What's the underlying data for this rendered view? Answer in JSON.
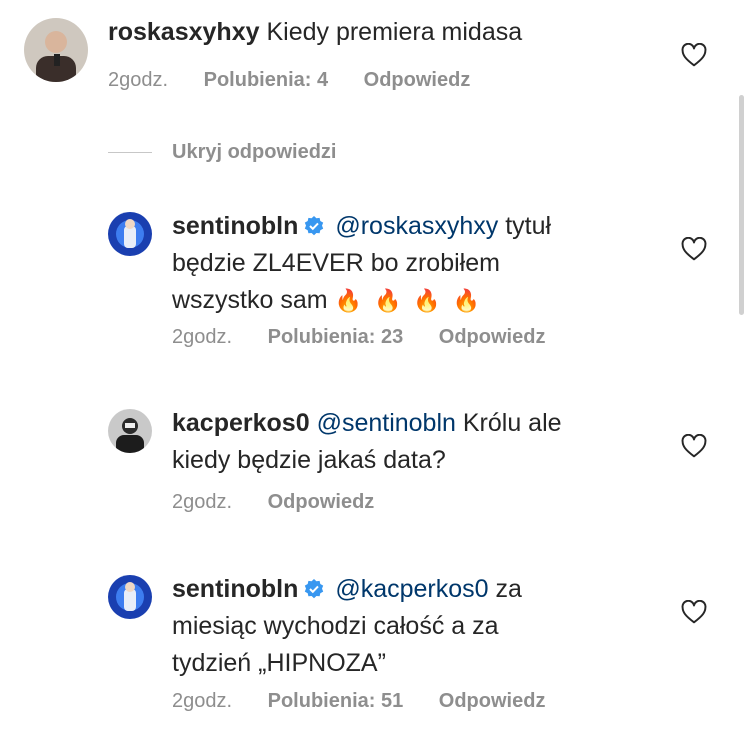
{
  "comment": {
    "username": "roskasxyhxy",
    "text": "Kiedy premiera midasa",
    "time": "2godz.",
    "likes": "Polubienia: 4",
    "reply": "Odpowiedz"
  },
  "hide_replies": "Ukryj odpowiedzi",
  "replies": [
    {
      "username": "sentinobln",
      "mention": "@roskasxyhxy",
      "line1": "tytuł",
      "line2": "będzie ZL4EVER bo zrobiłem",
      "line3": "wszystko sam",
      "emoji": "🔥🔥🔥🔥",
      "time": "2godz.",
      "likes": "Polubienia: 23",
      "reply": "Odpowiedz"
    },
    {
      "username": "kacperkos0",
      "mention": "@sentinobln",
      "line1": "Królu ale",
      "line2": "kiedy będzie jakaś data?",
      "time": "2godz.",
      "reply": "Odpowiedz"
    },
    {
      "username": "sentinobln",
      "mention": "@kacperkos0",
      "line1": "za",
      "line2": "miesiąc wychodzi całość a za",
      "line3": "tydzień „HIPNOZA”",
      "time": "2godz.",
      "likes": "Polubienia: 51",
      "reply": "Odpowiedz"
    }
  ],
  "icons": {
    "like": "heart-outline-icon",
    "verified": "verified-badge-icon"
  },
  "colors": {
    "text": "#262626",
    "meta": "#8e8e8e",
    "mention": "#00376b",
    "verified": "#3897f0"
  }
}
